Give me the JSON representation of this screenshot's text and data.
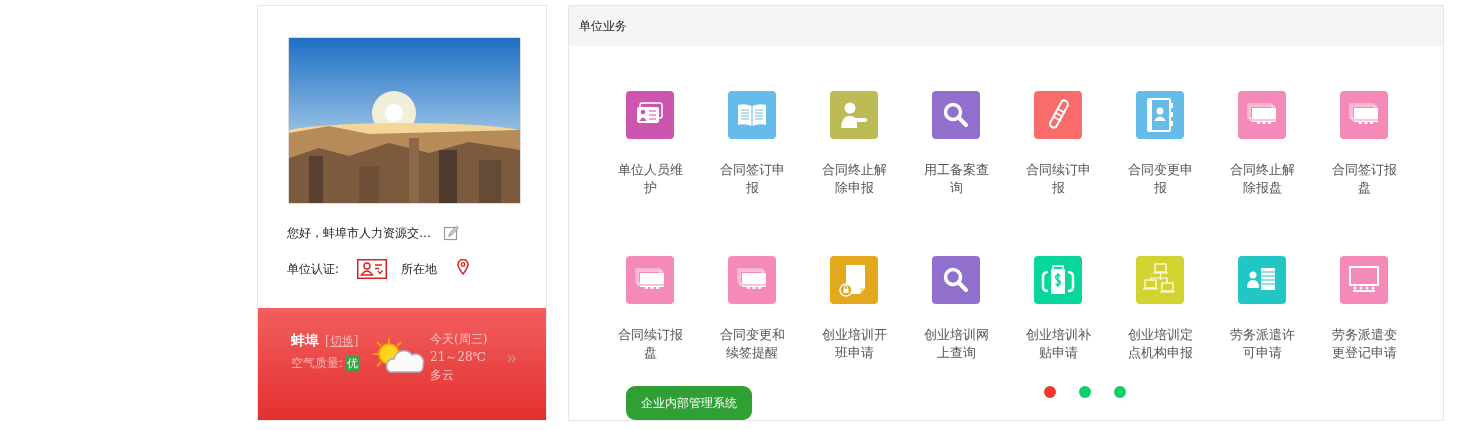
{
  "profile": {
    "greeting": "您好，蚌埠市人力资源交…",
    "certification_label": "单位认证:",
    "location_label": "所在地"
  },
  "weather": {
    "city": "蚌埠",
    "switch_link": "[切换]",
    "air_quality_label": "空气质量:",
    "air_quality": "优",
    "day": "今天(周三)",
    "temperature": "21～28℃",
    "condition": "多云"
  },
  "panel": {
    "title": "单位业务"
  },
  "services": [
    {
      "label": "单位人员维护",
      "kind": "idcard",
      "color": "#cc55b0"
    },
    {
      "label": "合同签订申报",
      "kind": "book",
      "color": "#66bce8"
    },
    {
      "label": "合同终止解除申报",
      "kind": "person",
      "color": "#bdbb56"
    },
    {
      "label": "用工备案查询",
      "kind": "search",
      "color": "#9070cc"
    },
    {
      "label": "合同续订申报",
      "kind": "scroll",
      "color": "#fa6b6b"
    },
    {
      "label": "合同变更申报",
      "kind": "contacts",
      "color": "#66bce8"
    },
    {
      "label": "合同终止解除报盘",
      "kind": "cards",
      "color": "#f58ab8"
    },
    {
      "label": "合同签订报盘",
      "kind": "cards",
      "color": "#f58ab8"
    },
    {
      "label": "合同续订报盘",
      "kind": "cards",
      "color": "#f58ab8"
    },
    {
      "label": "合同变更和续签提醒",
      "kind": "cards",
      "color": "#f58ab8"
    },
    {
      "label": "创业培训开班申请",
      "kind": "doclock",
      "color": "#e3a81c"
    },
    {
      "label": "创业培训网上查询",
      "kind": "search",
      "color": "#9070cc"
    },
    {
      "label": "创业培训补贴申请",
      "kind": "money",
      "color": "#08d69a"
    },
    {
      "label": "创业培训定点机构申报",
      "kind": "network",
      "color": "#d2d330"
    },
    {
      "label": "劳务派遣许可申请",
      "kind": "roster",
      "color": "#22c7c5"
    },
    {
      "label": "劳务派遣变更登记申请",
      "kind": "screen",
      "color": "#f58ab8"
    }
  ],
  "system_button": "企业内部管理系统",
  "pages": [
    {
      "selected": true
    },
    {
      "selected": false
    },
    {
      "selected": false
    }
  ]
}
